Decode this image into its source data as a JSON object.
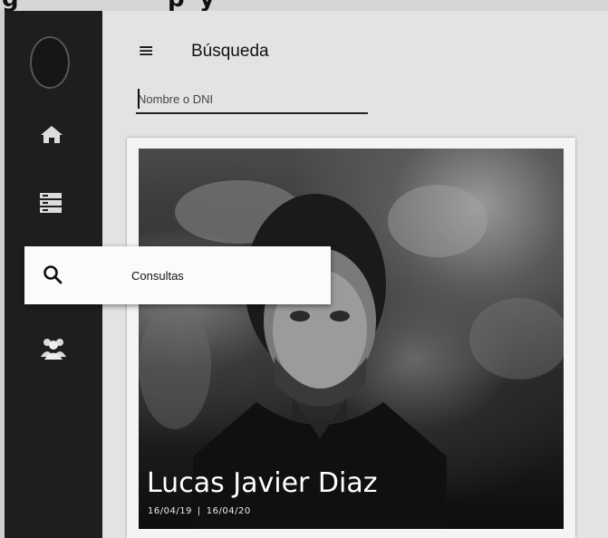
{
  "header": {
    "title": "Búsqueda",
    "menu_icon": "hamburger-icon"
  },
  "search": {
    "placeholder": "Nombre o DNI",
    "value": ""
  },
  "sidebar": {
    "items": [
      {
        "icon": "home-icon"
      },
      {
        "icon": "list-icon"
      },
      {
        "icon": "search-icon"
      },
      {
        "icon": "users-icon"
      }
    ]
  },
  "menu_popup": {
    "icon": "search-icon",
    "label": "Consultas"
  },
  "result_card": {
    "name": "Lucas Javier Diaz",
    "date_start": "16/04/19",
    "separator": "|",
    "date_end": "16/04/20"
  },
  "colors": {
    "sidebar_bg": "#1e1e1e",
    "page_bg": "#e3e3e3",
    "card_bg": "#f4f4f4"
  }
}
